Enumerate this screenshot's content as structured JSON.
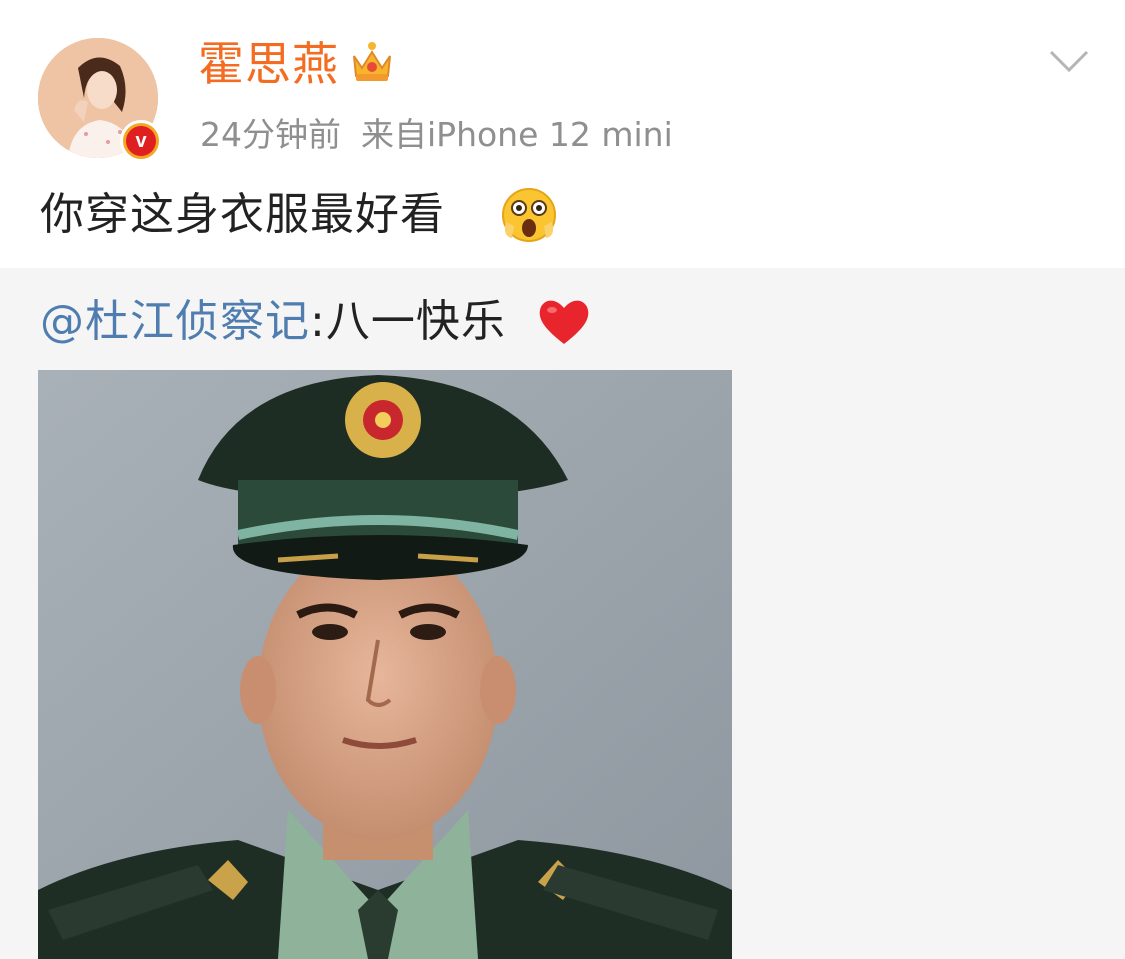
{
  "post": {
    "username": "霍思燕",
    "time": "24分钟前",
    "source": "来自iPhone 12 mini",
    "text": "你穿这身衣服最好看",
    "verified_badge_letter": "v",
    "icons": {
      "member": "crown-icon",
      "emoji": "surprised-emoji-icon",
      "menu": "chevron-down-icon"
    }
  },
  "repost": {
    "mention": "@杜江侦察记",
    "separator": ":",
    "text": "八一快乐",
    "emoji_icon": "heart-icon",
    "image_icon": "photo-soldier-portrait"
  },
  "colors": {
    "username": "#f36c21",
    "meta": "#8f8f8f",
    "mention": "#507daf",
    "body_text": "#222222",
    "repost_bg": "#f5f5f5",
    "heart": "#e8242c"
  }
}
